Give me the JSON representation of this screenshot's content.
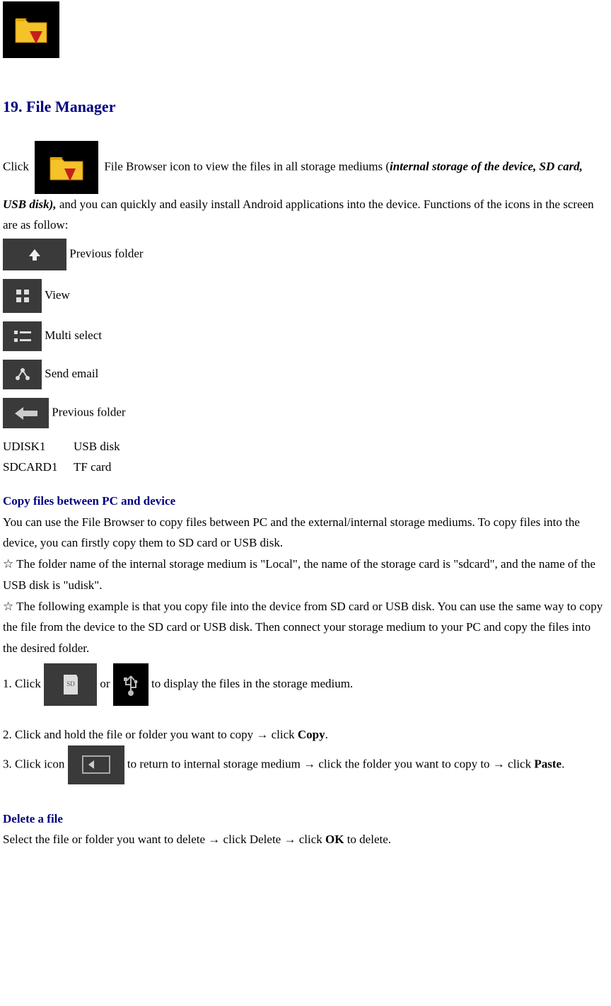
{
  "section_title": "19. File Manager",
  "intro": {
    "click": "Click",
    "after_icon": " File Browser icon to view the files in all storage mediums (",
    "italic": "internal storage of the device, SD card, USB disk),",
    "rest": " and you can quickly and easily install Android applications into the device. Functions of the icons in the screen are as follow:"
  },
  "icons": {
    "prev_folder": "Previous folder",
    "view": "View",
    "multi": "Multi select",
    "email": "Send email",
    "prev_folder2": "Previous folder"
  },
  "defs": {
    "udisk_k": "UDISK1",
    "udisk_v": "USB disk",
    "sd_k": "SDCARD1",
    "sd_v": "TF card"
  },
  "copy": {
    "heading": "Copy files between PC and device",
    "p1": "You can use the File Browser to copy files between PC and the external/internal storage mediums. To copy files into the device, you can firstly copy them to SD card or USB disk.",
    "star1": "☆    The folder name of the internal storage medium is \"Local\", the name of the storage card is \"sdcard\", and the name of the USB disk is \"udisk\".",
    "star2": "☆    The following example is that you copy file into the device from SD card or USB disk. You can use the same way to copy the file from the device to the SD card or USB disk. Then connect your storage medium to your PC and copy the files into the desired folder.",
    "step1_a": "1.     Click ",
    "step1_b": " or  ",
    "step1_c": " to display the files in the storage medium.",
    "step2_a": "2.     Click and hold the file or folder you want to copy → click ",
    "step2_copy": "Copy",
    "step2_b": ".",
    "step3_a": "3.     Click icon  ",
    "step3_b": "  to return to internal storage medium → click the folder you want to copy to → click ",
    "step3_paste": "Paste",
    "step3_c": "."
  },
  "delete": {
    "heading": "Delete a file",
    "p_a": "Select the file or folder you want to delete → click Delete → click ",
    "ok": "OK",
    "p_b": " to delete."
  }
}
